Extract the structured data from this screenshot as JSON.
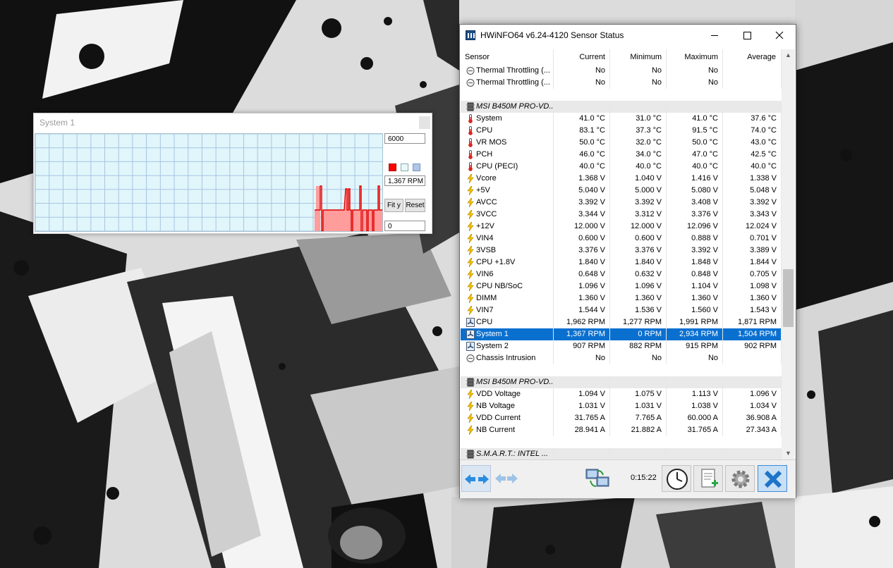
{
  "graph_window": {
    "title": "System 1",
    "max_value": "6000",
    "current_value": "1,367 RPM",
    "min_value": "0",
    "fit_label": "Fit y",
    "reset_label": "Reset",
    "line_color": "#ff0000"
  },
  "sensor_window": {
    "title": "HWiNFO64 v6.24-4120 Sensor Status",
    "columns": [
      "Sensor",
      "Current",
      "Minimum",
      "Maximum",
      "Average"
    ],
    "rows": [
      {
        "type": "sensor",
        "icon": "status",
        "name": "Thermal Throttling (...",
        "current": "No",
        "minimum": "No",
        "maximum": "No",
        "average": ""
      },
      {
        "type": "sensor",
        "icon": "status",
        "name": "Thermal Throttling (...",
        "current": "No",
        "minimum": "No",
        "maximum": "No",
        "average": ""
      },
      {
        "type": "spacer"
      },
      {
        "type": "group",
        "name": "MSI B450M PRO-VD..."
      },
      {
        "type": "sensor",
        "icon": "thermo",
        "name": "System",
        "current": "41.0 °C",
        "minimum": "31.0 °C",
        "maximum": "41.0 °C",
        "average": "37.6 °C"
      },
      {
        "type": "sensor",
        "icon": "thermo",
        "name": "CPU",
        "current": "83.1 °C",
        "minimum": "37.3 °C",
        "maximum": "91.5 °C",
        "average": "74.0 °C"
      },
      {
        "type": "sensor",
        "icon": "thermo",
        "name": "VR MOS",
        "current": "50.0 °C",
        "minimum": "32.0 °C",
        "maximum": "50.0 °C",
        "average": "43.0 °C"
      },
      {
        "type": "sensor",
        "icon": "thermo",
        "name": "PCH",
        "current": "46.0 °C",
        "minimum": "34.0 °C",
        "maximum": "47.0 °C",
        "average": "42.5 °C"
      },
      {
        "type": "sensor",
        "icon": "thermo",
        "name": "CPU (PECI)",
        "current": "40.0 °C",
        "minimum": "40.0 °C",
        "maximum": "40.0 °C",
        "average": "40.0 °C"
      },
      {
        "type": "sensor",
        "icon": "bolt",
        "name": "Vcore",
        "current": "1.368 V",
        "minimum": "1.040 V",
        "maximum": "1.416 V",
        "average": "1.338 V"
      },
      {
        "type": "sensor",
        "icon": "bolt",
        "name": "+5V",
        "current": "5.040 V",
        "minimum": "5.000 V",
        "maximum": "5.080 V",
        "average": "5.048 V"
      },
      {
        "type": "sensor",
        "icon": "bolt",
        "name": "AVCC",
        "current": "3.392 V",
        "minimum": "3.392 V",
        "maximum": "3.408 V",
        "average": "3.392 V"
      },
      {
        "type": "sensor",
        "icon": "bolt",
        "name": "3VCC",
        "current": "3.344 V",
        "minimum": "3.312 V",
        "maximum": "3.376 V",
        "average": "3.343 V"
      },
      {
        "type": "sensor",
        "icon": "bolt",
        "name": "+12V",
        "current": "12.000 V",
        "minimum": "12.000 V",
        "maximum": "12.096 V",
        "average": "12.024 V"
      },
      {
        "type": "sensor",
        "icon": "bolt",
        "name": "VIN4",
        "current": "0.600 V",
        "minimum": "0.600 V",
        "maximum": "0.888 V",
        "average": "0.701 V"
      },
      {
        "type": "sensor",
        "icon": "bolt",
        "name": "3VSB",
        "current": "3.376 V",
        "minimum": "3.376 V",
        "maximum": "3.392 V",
        "average": "3.389 V"
      },
      {
        "type": "sensor",
        "icon": "bolt",
        "name": "CPU +1.8V",
        "current": "1.840 V",
        "minimum": "1.840 V",
        "maximum": "1.848 V",
        "average": "1.844 V"
      },
      {
        "type": "sensor",
        "icon": "bolt",
        "name": "VIN6",
        "current": "0.648 V",
        "minimum": "0.632 V",
        "maximum": "0.848 V",
        "average": "0.705 V"
      },
      {
        "type": "sensor",
        "icon": "bolt",
        "name": "CPU NB/SoC",
        "current": "1.096 V",
        "minimum": "1.096 V",
        "maximum": "1.104 V",
        "average": "1.098 V"
      },
      {
        "type": "sensor",
        "icon": "bolt",
        "name": "DIMM",
        "current": "1.360 V",
        "minimum": "1.360 V",
        "maximum": "1.360 V",
        "average": "1.360 V"
      },
      {
        "type": "sensor",
        "icon": "bolt",
        "name": "VIN7",
        "current": "1.544 V",
        "minimum": "1.536 V",
        "maximum": "1.560 V",
        "average": "1.543 V"
      },
      {
        "type": "sensor",
        "icon": "fan",
        "name": "CPU",
        "current": "1,962 RPM",
        "minimum": "1,277 RPM",
        "maximum": "1,991 RPM",
        "average": "1,871 RPM"
      },
      {
        "type": "sensor",
        "icon": "fan",
        "name": "System 1",
        "current": "1,367 RPM",
        "minimum": "0 RPM",
        "maximum": "2,934 RPM",
        "average": "1,504 RPM",
        "selected": true
      },
      {
        "type": "sensor",
        "icon": "fan",
        "name": "System 2",
        "current": "907 RPM",
        "minimum": "882 RPM",
        "maximum": "915 RPM",
        "average": "902 RPM"
      },
      {
        "type": "sensor",
        "icon": "status",
        "name": "Chassis Intrusion",
        "current": "No",
        "minimum": "No",
        "maximum": "No",
        "average": ""
      },
      {
        "type": "spacer"
      },
      {
        "type": "group",
        "name": "MSI B450M PRO-VD..."
      },
      {
        "type": "sensor",
        "icon": "bolt",
        "name": "VDD Voltage",
        "current": "1.094 V",
        "minimum": "1.075 V",
        "maximum": "1.113 V",
        "average": "1.096 V"
      },
      {
        "type": "sensor",
        "icon": "bolt",
        "name": "NB Voltage",
        "current": "1.031 V",
        "minimum": "1.031 V",
        "maximum": "1.038 V",
        "average": "1.034 V"
      },
      {
        "type": "sensor",
        "icon": "bolt",
        "name": "VDD Current",
        "current": "31.765 A",
        "minimum": "7.765 A",
        "maximum": "60.000 A",
        "average": "36.908 A"
      },
      {
        "type": "sensor",
        "icon": "bolt",
        "name": "NB Current",
        "current": "28.941 A",
        "minimum": "21.882 A",
        "maximum": "31.765 A",
        "average": "27.343 A"
      },
      {
        "type": "spacer"
      },
      {
        "type": "group",
        "name": "S.M.A.R.T.: INTEL ..."
      }
    ],
    "elapsed_time": "0:15:22",
    "selection_color": "#0a70d0"
  }
}
